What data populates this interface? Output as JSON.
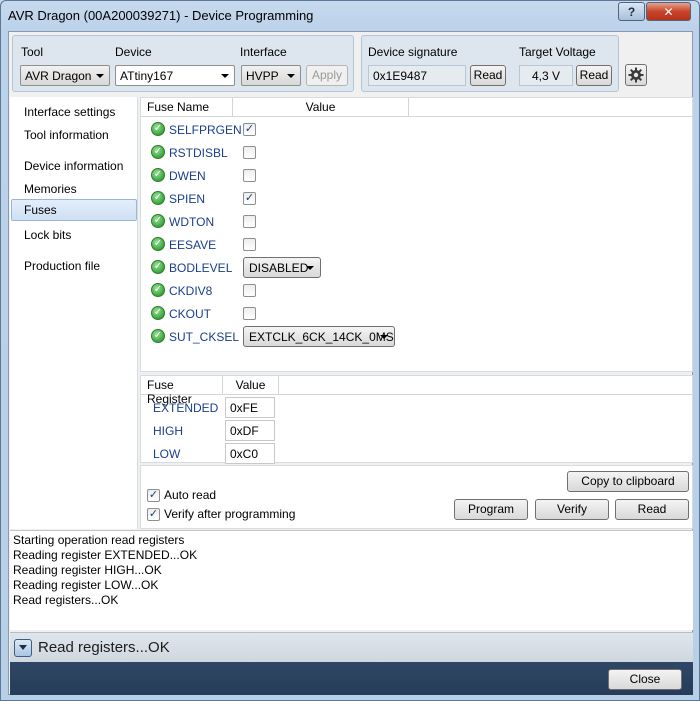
{
  "window": {
    "title": "AVR Dragon (00A200039271) - Device Programming",
    "help_label": "?",
    "close_label": "✕"
  },
  "tool_group": {
    "tool_label": "Tool",
    "tool_value": "AVR Dragon",
    "device_label": "Device",
    "device_value": "ATtiny167",
    "interface_label": "Interface",
    "interface_value": "HVPP",
    "apply_label": "Apply"
  },
  "signature_group": {
    "signature_label": "Device signature",
    "signature_value": "0x1E9487",
    "signature_read_label": "Read",
    "voltage_label": "Target Voltage",
    "voltage_value": "4,3 V",
    "voltage_read_label": "Read"
  },
  "nav": {
    "items": [
      {
        "label": "Interface settings"
      },
      {
        "label": "Tool information"
      },
      {
        "label": "Device information"
      },
      {
        "label": "Memories"
      },
      {
        "label": "Fuses"
      },
      {
        "label": "Lock bits"
      },
      {
        "label": "Production file"
      }
    ],
    "selected": "Fuses"
  },
  "fuses": {
    "col_name": "Fuse Name",
    "col_value": "Value",
    "rows": [
      {
        "name": "SELFPRGEN",
        "type": "checkbox",
        "checked": true
      },
      {
        "name": "RSTDISBL",
        "type": "checkbox",
        "checked": false
      },
      {
        "name": "DWEN",
        "type": "checkbox",
        "checked": false
      },
      {
        "name": "SPIEN",
        "type": "checkbox",
        "checked": true
      },
      {
        "name": "WDTON",
        "type": "checkbox",
        "checked": false
      },
      {
        "name": "EESAVE",
        "type": "checkbox",
        "checked": false
      },
      {
        "name": "BODLEVEL",
        "type": "select",
        "value": "DISABLED"
      },
      {
        "name": "CKDIV8",
        "type": "checkbox",
        "checked": false
      },
      {
        "name": "CKOUT",
        "type": "checkbox",
        "checked": false
      },
      {
        "name": "SUT_CKSEL",
        "type": "select",
        "value": "EXTCLK_6CK_14CK_0MS"
      }
    ]
  },
  "registers": {
    "col_name": "Fuse Register",
    "col_value": "Value",
    "rows": [
      {
        "name": "EXTENDED",
        "value": "0xFE"
      },
      {
        "name": "HIGH",
        "value": "0xDF"
      },
      {
        "name": "LOW",
        "value": "0xC0"
      }
    ]
  },
  "actions": {
    "auto_read_label": "Auto read",
    "auto_read_checked": true,
    "verify_label": "Verify after programming",
    "verify_checked": true,
    "copy_label": "Copy to clipboard",
    "program_label": "Program",
    "verify_button_label": "Verify",
    "read_label": "Read"
  },
  "log": {
    "lines": [
      "Starting operation read registers",
      "Reading register EXTENDED...OK",
      "Reading register HIGH...OK",
      "Reading register LOW...OK",
      "Read registers...OK"
    ]
  },
  "status": {
    "text": "Read registers...OK"
  },
  "footer": {
    "close_label": "Close"
  }
}
